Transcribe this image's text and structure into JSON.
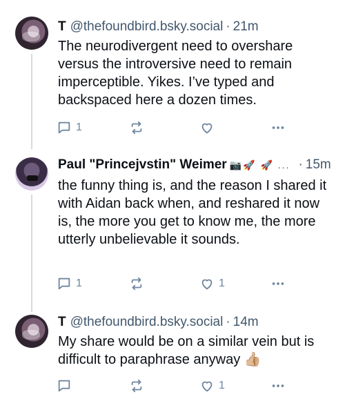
{
  "posts": [
    {
      "name": "T",
      "handle": "@thefoundbird.bsky.social",
      "time": "21m",
      "text": "The neurodivergent need to overshare versus the introversive need to remain imperceptible. Yikes. I’ve typed and backspaced here a dozen times.",
      "reply_count": "1",
      "like_count": ""
    },
    {
      "name": "Paul \"Princejvstin\" Weimer",
      "name_emojis": "📷🚀 🚀 ...",
      "time": "15m",
      "text": "the funny thing is, and the reason I shared it with Aidan back when, and reshared it now is, the more you get to know me, the more utterly unbelievable it sounds.",
      "reply_count": "1",
      "like_count": "1"
    },
    {
      "name": "T",
      "handle": "@thefoundbird.bsky.social",
      "time": "14m",
      "text": "My share would be on a similar vein but is difficult to paraphrase anyway 👍🏼",
      "reply_count": "",
      "like_count": "1"
    }
  ],
  "separator": "·",
  "icons": [
    "reply-icon",
    "repost-icon",
    "like-icon",
    "more-icon"
  ],
  "colors": {
    "text": "#0b0f14",
    "muted": "#42576c",
    "icon": "#6f869f",
    "thread_line": "#d4dbe2"
  }
}
